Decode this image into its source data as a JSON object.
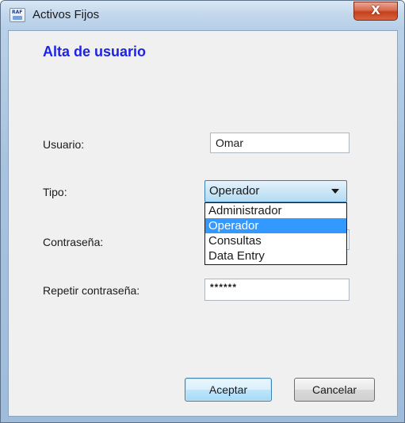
{
  "window": {
    "title": "Activos Fijos",
    "icon_text": "RAF",
    "close_glyph": "X"
  },
  "form": {
    "title": "Alta de usuario",
    "usuario_label": "Usuario:",
    "usuario_value": "Omar",
    "tipo_label": "Tipo:",
    "tipo_selected": "Operador",
    "tipo_options": [
      "Administrador",
      "Operador",
      "Consultas",
      "Data Entry"
    ],
    "contrasena_label": "Contraseña:",
    "repetir_label": "Repetir contraseña:",
    "repetir_value": "******"
  },
  "buttons": {
    "aceptar": "Aceptar",
    "cancelar": "Cancelar"
  },
  "colors": {
    "form_title": "#1d22e6",
    "selection": "#3399ff"
  }
}
